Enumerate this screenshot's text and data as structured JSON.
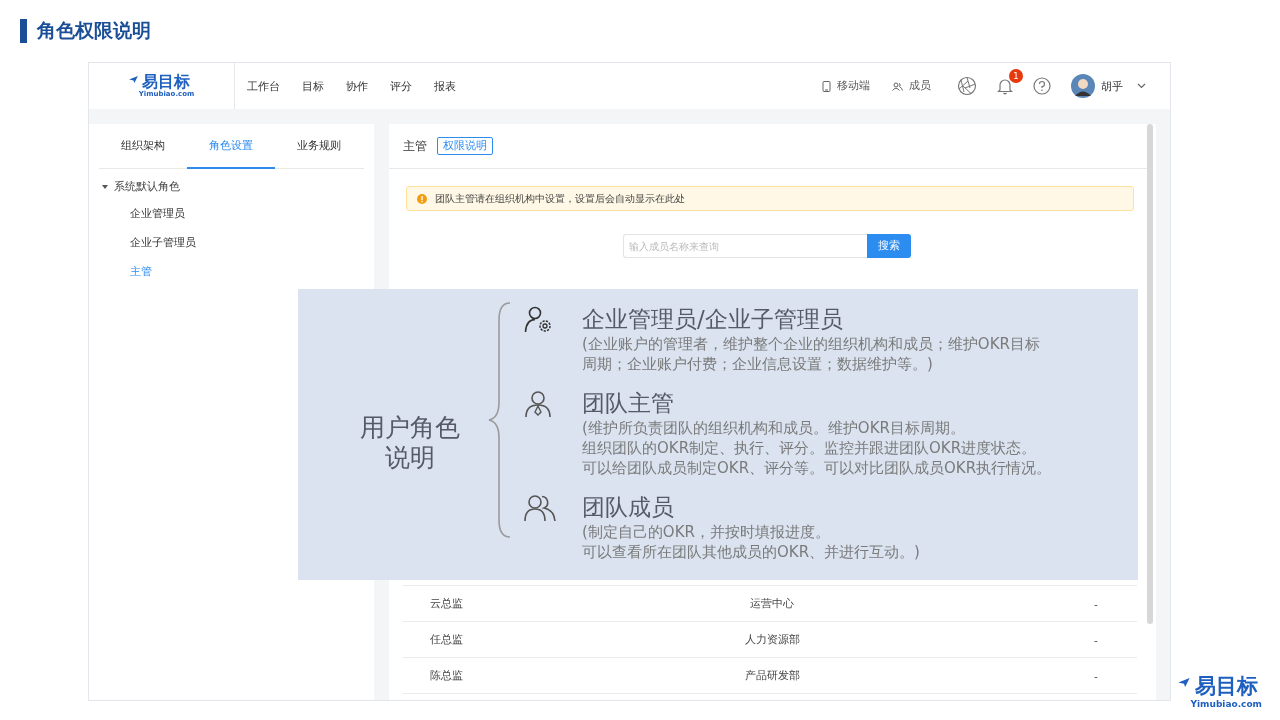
{
  "title": "角色权限说明",
  "app": {
    "logo": {
      "mark": "易目标",
      "sub": "Yimubiao.com"
    },
    "nav": [
      "工作台",
      "目标",
      "协作",
      "评分",
      "报表"
    ],
    "toolbar": [
      {
        "kind": "mobile",
        "label": "移动端"
      },
      {
        "kind": "members",
        "label": "成员"
      }
    ],
    "notifications": {
      "count": "1"
    },
    "user": {
      "name": "胡乎"
    },
    "left_tabs": [
      {
        "label": "组织架构",
        "selected": false
      },
      {
        "label": "角色设置",
        "selected": true
      },
      {
        "label": "业务规则",
        "selected": false
      }
    ],
    "tree": [
      {
        "label": "系统默认角色",
        "expanded": true,
        "children": [
          {
            "label": "企业管理员",
            "selected": false
          },
          {
            "label": "企业子管理员",
            "selected": false
          },
          {
            "label": "主管",
            "selected": true
          }
        ]
      }
    ],
    "panel": {
      "title": "主管",
      "tag": "权限说明",
      "alert": "团队主管请在组织机构中设置，设置后会自动显示在此处",
      "search": {
        "placeholder": "输入成员名称来查询",
        "button": "搜索"
      }
    },
    "table": {
      "rows": [
        {
          "member": "云总监",
          "department": "运营中心",
          "action": "-"
        },
        {
          "member": "任总监",
          "department": "人力资源部",
          "action": "-"
        },
        {
          "member": "陈总监",
          "department": "产品研发部",
          "action": "-"
        }
      ]
    }
  },
  "overlay": {
    "heading": [
      "用户角色",
      "说明"
    ],
    "roles": [
      {
        "kind": "admin",
        "title": "企业管理员/企业子管理员",
        "lines": [
          "(企业账户的管理者，维护整个企业的组织机构和成员；维护OKR目标",
          "周期；企业账户付费；企业信息设置；数据维护等。)"
        ]
      },
      {
        "kind": "leader",
        "title": "团队主管",
        "lines": [
          "(维护所负责团队的组织机构和成员。维护OKR目标周期。",
          "组织团队的OKR制定、执行、评分。监控并跟进团队OKR进度状态。",
          "可以给团队成员制定OKR、评分等。可以对比团队成员OKR执行情况。"
        ]
      },
      {
        "kind": "member",
        "title": "团队成员",
        "lines": [
          "(制定自己的OKR，并按时填报进度。",
          "可以查看所在团队其他成员的OKR、并进行互动。)"
        ]
      }
    ]
  },
  "footer_logo": {
    "mark": "易目标",
    "sub": "Yimubiao.com"
  }
}
